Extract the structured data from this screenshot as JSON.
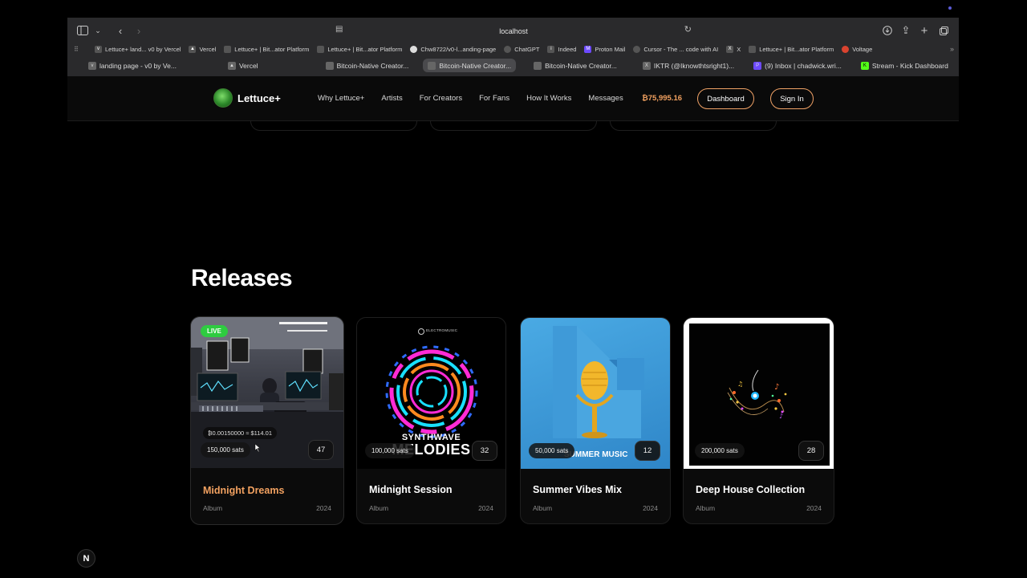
{
  "browser": {
    "url": "localhost",
    "bookmarks": [
      {
        "label": "Lettuce+ land... v0 by Vercel",
        "icon": "v0-icon"
      },
      {
        "label": "Vercel",
        "icon": "vercel-icon"
      },
      {
        "label": "Lettuce+ | Bit...ator Platform",
        "icon": "page-icon"
      },
      {
        "label": "Lettuce+ | Bit...ator Platform",
        "icon": "page-icon"
      },
      {
        "label": "Chw8722/v0-l...anding-page",
        "icon": "github-icon"
      },
      {
        "label": "ChatGPT",
        "icon": "chatgpt-icon"
      },
      {
        "label": "Indeed",
        "icon": "indeed-icon"
      },
      {
        "label": "Proton Mail",
        "icon": "proton-icon"
      },
      {
        "label": "Cursor - The ... code with AI",
        "icon": "cursor-icon"
      },
      {
        "label": "X",
        "icon": "x-icon"
      },
      {
        "label": "Lettuce+ | Bit...ator Platform",
        "icon": "page-icon"
      },
      {
        "label": "Voltage",
        "icon": "voltage-icon"
      }
    ],
    "tabs": [
      {
        "label": "landing page - v0 by Ve...",
        "active": false
      },
      {
        "label": "Vercel",
        "active": false
      },
      {
        "label": "Bitcoin-Native Creator...",
        "active": false
      },
      {
        "label": "Bitcoin-Native Creator...",
        "active": true
      },
      {
        "label": "Bitcoin-Native Creator...",
        "active": false
      },
      {
        "label": "IKTR (@Iknowthtsright1)...",
        "active": false
      },
      {
        "label": "(9) Inbox | chadwick.wri...",
        "active": false
      },
      {
        "label": "Stream - Kick Dashboard",
        "active": false
      }
    ]
  },
  "site": {
    "brand": "Lettuce+",
    "nav": [
      "Why Lettuce+",
      "Artists",
      "For Creators",
      "For Fans",
      "How It Works",
      "Messages"
    ],
    "balance": "₿75,995.16",
    "dashboard_label": "Dashboard",
    "signin_label": "Sign In"
  },
  "releases": {
    "heading": "Releases",
    "cards": [
      {
        "title": "Midnight Dreams",
        "type": "Album",
        "year": "2024",
        "sats": "150,000 sats",
        "count": "47",
        "price": "₿0.00150000 ≈ $114.01",
        "live": "LIVE"
      },
      {
        "title": "Midnight Session",
        "type": "Album",
        "year": "2024",
        "sats": "100,000 sats",
        "count": "32",
        "art_text_top": "SYNTHWAVE",
        "art_text_bottom": "MELODIES",
        "art_brand": "ELECTROMUSIC"
      },
      {
        "title": "Summer Vibes Mix",
        "type": "Album",
        "year": "2024",
        "sats": "50,000 sats",
        "count": "12",
        "art_text": "SUMMER MUSIC"
      },
      {
        "title": "Deep House Collection",
        "type": "Album",
        "year": "2024",
        "sats": "200,000 sats",
        "count": "28"
      }
    ]
  },
  "next_badge": "N"
}
